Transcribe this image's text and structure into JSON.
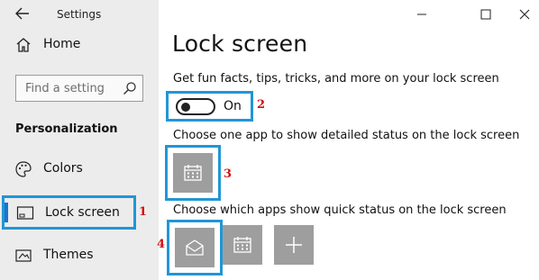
{
  "window": {
    "title": "Settings",
    "back_icon": "back-arrow-icon"
  },
  "sidebar": {
    "home": {
      "label": "Home",
      "icon": "home-icon"
    },
    "search": {
      "placeholder": "Find a setting",
      "icon": "search-icon"
    },
    "section_title": "Personalization",
    "items": [
      {
        "label": "Colors",
        "icon": "palette-icon"
      },
      {
        "label": "Lock screen",
        "icon": "lock-screen-icon",
        "selected": true
      },
      {
        "label": "Themes",
        "icon": "themes-icon"
      }
    ]
  },
  "main": {
    "title": "Lock screen",
    "fun_facts": {
      "label": "Get fun facts, tips, tricks, and more on your lock screen",
      "toggle_state": "On",
      "toggle_on": false
    },
    "detailed_status": {
      "label": "Choose one app to show detailed status on the lock screen",
      "app_icon": "calendar-icon"
    },
    "quick_status": {
      "label": "Choose which apps show quick status on the lock screen",
      "apps": [
        "mail-icon",
        "calendar-icon",
        "add-icon"
      ]
    }
  },
  "annotations": [
    "1",
    "2",
    "3",
    "4"
  ],
  "colors": {
    "highlight_border": "#2196d6",
    "annotation_red": "#d10f0f",
    "tile_gray": "#9e9e9e",
    "sidebar_bg": "#ececec",
    "accent": "#1a75c9"
  }
}
